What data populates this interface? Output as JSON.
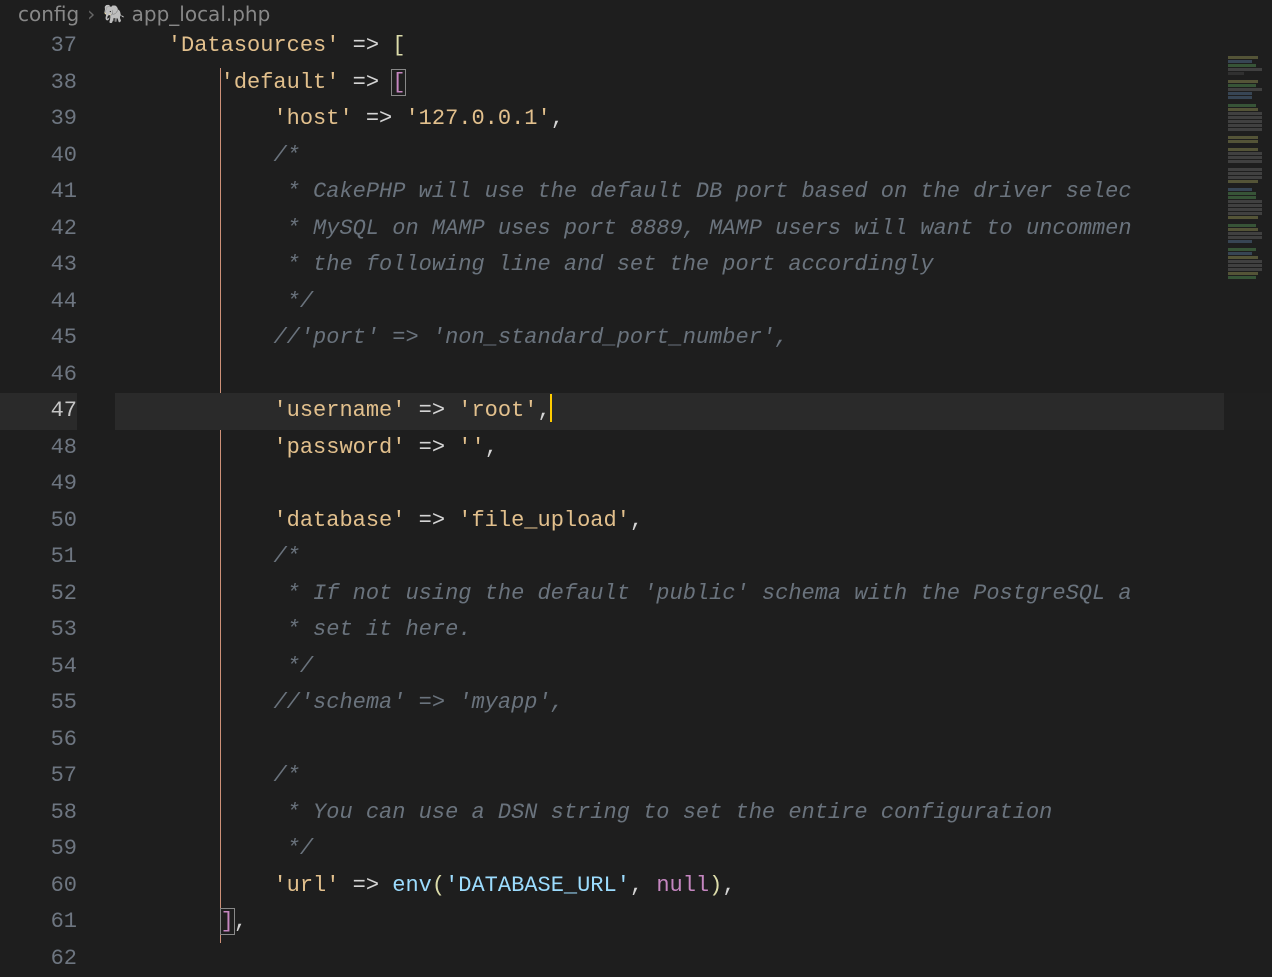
{
  "breadcrumb": {
    "folder": "config",
    "file": "app_local.php"
  },
  "gutter": {
    "start": 37,
    "end": 62,
    "active": 47
  },
  "code": {
    "l37": {
      "key": "'Datasources'",
      "arrow": "=>",
      "br": "["
    },
    "l38": {
      "key": "'default'",
      "arrow": "=>",
      "br": "["
    },
    "l39": {
      "key": "'host'",
      "arrow": "=>",
      "val": "'127.0.0.1'"
    },
    "l40": "/*",
    "l41": " * CakePHP will use the default DB port based on the driver selec",
    "l42": " * MySQL on MAMP uses port 8889, MAMP users will want to uncommen",
    "l43": " * the following line and set the port accordingly",
    "l44": " */",
    "l45": "//'port' => 'non_standard_port_number',",
    "l47": {
      "key": "'username'",
      "arrow": "=>",
      "val": "'root'"
    },
    "l48": {
      "key": "'password'",
      "arrow": "=>",
      "val": "''"
    },
    "l50": {
      "key": "'database'",
      "arrow": "=>",
      "val": "'file_upload'"
    },
    "l51": "/*",
    "l52": " * If not using the default 'public' schema with the PostgreSQL a",
    "l53": " * set it here.",
    "l54": " */",
    "l55": "//'schema' => 'myapp',",
    "l57": "/*",
    "l58": " * You can use a DSN string to set the entire configuration",
    "l59": " */",
    "l60": {
      "key": "'url'",
      "arrow": "=>",
      "func": "env",
      "arg1": "'DATABASE_URL'",
      "arg2": "null"
    },
    "l61": {
      "br": "]"
    }
  }
}
